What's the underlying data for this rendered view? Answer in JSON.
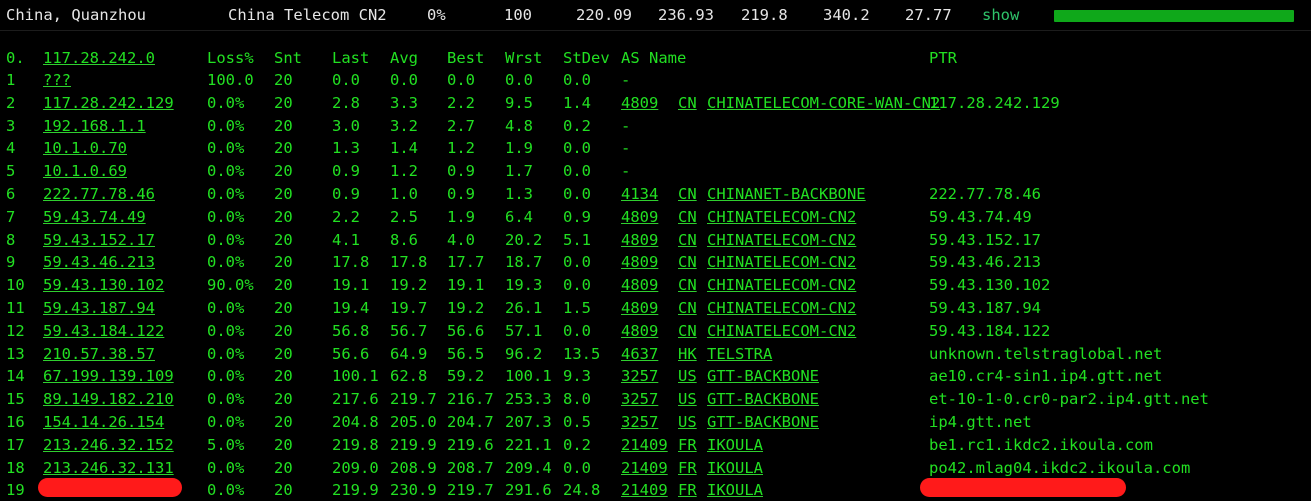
{
  "header_bar": {
    "location": "China, Quanzhou",
    "isp": "China Telecom CN2",
    "loss": "0%",
    "sent": "100",
    "last": "220.09",
    "avg": "236.93",
    "best": "219.8",
    "worst": "340.2",
    "stdev": "27.77",
    "show_label": "show"
  },
  "columns": [
    "0.",
    "117.28.242.0",
    "Loss%",
    "Snt",
    "Last",
    "Avg",
    "Best",
    "Wrst",
    "StDev",
    "AS Name",
    "PTR"
  ],
  "hops": [
    {
      "n": "1",
      "ip": "???",
      "loss": "100.0",
      "snt": "20",
      "last": "0.0",
      "avg": "0.0",
      "best": "0.0",
      "wrst": "0.0",
      "stdev": "0.0",
      "asn": "",
      "cc": "",
      "asname": "-",
      "ptr": ""
    },
    {
      "n": "2",
      "ip": "117.28.242.129",
      "loss": "0.0%",
      "snt": "20",
      "last": "2.8",
      "avg": "3.3",
      "best": "2.2",
      "wrst": "9.5",
      "stdev": "1.4",
      "asn": "4809",
      "cc": "CN",
      "asname": "CHINATELECOM-CORE-WAN-CN2",
      "ptr": "117.28.242.129"
    },
    {
      "n": "3",
      "ip": "192.168.1.1",
      "loss": "0.0%",
      "snt": "20",
      "last": "3.0",
      "avg": "3.2",
      "best": "2.7",
      "wrst": "4.8",
      "stdev": "0.2",
      "asn": "",
      "cc": "",
      "asname": "-",
      "ptr": ""
    },
    {
      "n": "4",
      "ip": "10.1.0.70",
      "loss": "0.0%",
      "snt": "20",
      "last": "1.3",
      "avg": "1.4",
      "best": "1.2",
      "wrst": "1.9",
      "stdev": "0.0",
      "asn": "",
      "cc": "",
      "asname": "-",
      "ptr": ""
    },
    {
      "n": "5",
      "ip": "10.1.0.69",
      "loss": "0.0%",
      "snt": "20",
      "last": "0.9",
      "avg": "1.2",
      "best": "0.9",
      "wrst": "1.7",
      "stdev": "0.0",
      "asn": "",
      "cc": "",
      "asname": "-",
      "ptr": ""
    },
    {
      "n": "6",
      "ip": "222.77.78.46",
      "loss": "0.0%",
      "snt": "20",
      "last": "0.9",
      "avg": "1.0",
      "best": "0.9",
      "wrst": "1.3",
      "stdev": "0.0",
      "asn": "4134",
      "cc": "CN",
      "asname": "CHINANET-BACKBONE",
      "ptr": "222.77.78.46"
    },
    {
      "n": "7",
      "ip": "59.43.74.49",
      "loss": "0.0%",
      "snt": "20",
      "last": "2.2",
      "avg": "2.5",
      "best": "1.9",
      "wrst": "6.4",
      "stdev": "0.9",
      "asn": "4809",
      "cc": "CN",
      "asname": "CHINATELECOM-CN2",
      "ptr": "59.43.74.49"
    },
    {
      "n": "8",
      "ip": "59.43.152.17",
      "loss": "0.0%",
      "snt": "20",
      "last": "4.1",
      "avg": "8.6",
      "best": "4.0",
      "wrst": "20.2",
      "stdev": "5.1",
      "asn": "4809",
      "cc": "CN",
      "asname": "CHINATELECOM-CN2",
      "ptr": "59.43.152.17"
    },
    {
      "n": "9",
      "ip": "59.43.46.213",
      "loss": "0.0%",
      "snt": "20",
      "last": "17.8",
      "avg": "17.8",
      "best": "17.7",
      "wrst": "18.7",
      "stdev": "0.0",
      "asn": "4809",
      "cc": "CN",
      "asname": "CHINATELECOM-CN2",
      "ptr": "59.43.46.213"
    },
    {
      "n": "10",
      "ip": "59.43.130.102",
      "loss": "90.0%",
      "snt": "20",
      "last": "19.1",
      "avg": "19.2",
      "best": "19.1",
      "wrst": "19.3",
      "stdev": "0.0",
      "asn": "4809",
      "cc": "CN",
      "asname": "CHINATELECOM-CN2",
      "ptr": "59.43.130.102"
    },
    {
      "n": "11",
      "ip": "59.43.187.94",
      "loss": "0.0%",
      "snt": "20",
      "last": "19.4",
      "avg": "19.7",
      "best": "19.2",
      "wrst": "26.1",
      "stdev": "1.5",
      "asn": "4809",
      "cc": "CN",
      "asname": "CHINATELECOM-CN2",
      "ptr": "59.43.187.94"
    },
    {
      "n": "12",
      "ip": "59.43.184.122",
      "loss": "0.0%",
      "snt": "20",
      "last": "56.8",
      "avg": "56.7",
      "best": "56.6",
      "wrst": "57.1",
      "stdev": "0.0",
      "asn": "4809",
      "cc": "CN",
      "asname": "CHINATELECOM-CN2",
      "ptr": "59.43.184.122"
    },
    {
      "n": "13",
      "ip": "210.57.38.57",
      "loss": "0.0%",
      "snt": "20",
      "last": "56.6",
      "avg": "64.9",
      "best": "56.5",
      "wrst": "96.2",
      "stdev": "13.5",
      "asn": "4637",
      "cc": "HK",
      "asname": "TELSTRA",
      "ptr": "unknown.telstraglobal.net"
    },
    {
      "n": "14",
      "ip": "67.199.139.109",
      "loss": "0.0%",
      "snt": "20",
      "last": "100.1",
      "avg": "62.8",
      "best": "59.2",
      "wrst": "100.1",
      "stdev": "9.3",
      "asn": "3257",
      "cc": "US",
      "asname": "GTT-BACKBONE",
      "ptr": "ae10.cr4-sin1.ip4.gtt.net"
    },
    {
      "n": "15",
      "ip": "89.149.182.210",
      "loss": "0.0%",
      "snt": "20",
      "last": "217.6",
      "avg": "219.7",
      "best": "216.7",
      "wrst": "253.3",
      "stdev": "8.0",
      "asn": "3257",
      "cc": "US",
      "asname": "GTT-BACKBONE",
      "ptr": "et-10-1-0.cr0-par2.ip4.gtt.net"
    },
    {
      "n": "16",
      "ip": "154.14.26.154",
      "loss": "0.0%",
      "snt": "20",
      "last": "204.8",
      "avg": "205.0",
      "best": "204.7",
      "wrst": "207.3",
      "stdev": "0.5",
      "asn": "3257",
      "cc": "US",
      "asname": "GTT-BACKBONE",
      "ptr": "ip4.gtt.net"
    },
    {
      "n": "17",
      "ip": "213.246.32.152",
      "loss": "5.0%",
      "snt": "20",
      "last": "219.8",
      "avg": "219.9",
      "best": "219.6",
      "wrst": "221.1",
      "stdev": "0.2",
      "asn": "21409",
      "cc": "FR",
      "asname": "IKOULA",
      "ptr": "be1.rc1.ikdc2.ikoula.com"
    },
    {
      "n": "18",
      "ip": "213.246.32.131",
      "loss": "0.0%",
      "snt": "20",
      "last": "209.0",
      "avg": "208.9",
      "best": "208.7",
      "wrst": "209.4",
      "stdev": "0.0",
      "asn": "21409",
      "cc": "FR",
      "asname": "IKOULA",
      "ptr": "po42.mlag04.ikdc2.ikoula.com"
    },
    {
      "n": "19",
      "ip": "",
      "loss": "0.0%",
      "snt": "20",
      "last": "219.9",
      "avg": "230.9",
      "best": "219.7",
      "wrst": "291.6",
      "stdev": "24.8",
      "asn": "21409",
      "cc": "FR",
      "asname": "IKOULA",
      "ptr": ""
    }
  ],
  "colors": {
    "text": "#22e022",
    "background": "#000000",
    "header_text": "#e6e6e6",
    "redaction": "#ff1a1a"
  }
}
